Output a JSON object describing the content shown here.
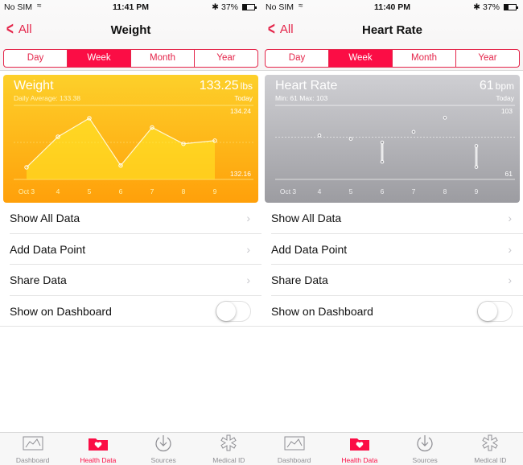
{
  "screens": [
    {
      "status": {
        "carrier": "No SIM",
        "time": "11:41 PM",
        "battery": "37%"
      },
      "nav": {
        "back_label": "All",
        "title": "Weight"
      },
      "segments": [
        {
          "label": "Day",
          "active": false
        },
        {
          "label": "Week",
          "active": true
        },
        {
          "label": "Month",
          "active": false
        },
        {
          "label": "Year",
          "active": false
        }
      ],
      "card": {
        "title": "Weight",
        "subtitle": "Daily Average: 133.38",
        "value": "133.25",
        "unit": "lbs",
        "when": "Today",
        "color_top": "#fdd02a",
        "color_bottom": "#ffa00a"
      },
      "list": [
        {
          "label": "Show All Data"
        },
        {
          "label": "Add Data Point"
        },
        {
          "label": "Share Data"
        },
        {
          "label": "Show on Dashboard",
          "toggle": false
        }
      ]
    },
    {
      "status": {
        "carrier": "No SIM",
        "time": "11:40 PM",
        "battery": "37%"
      },
      "nav": {
        "back_label": "All",
        "title": "Heart Rate"
      },
      "segments": [
        {
          "label": "Day",
          "active": false
        },
        {
          "label": "Week",
          "active": true
        },
        {
          "label": "Month",
          "active": false
        },
        {
          "label": "Year",
          "active": false
        }
      ],
      "card": {
        "title": "Heart Rate",
        "subtitle": "Min: 61  Max: 103",
        "value": "61",
        "unit": "bpm",
        "when": "Today",
        "color_top": "#cfcfd3",
        "color_bottom": "#9c9ca1"
      },
      "list": [
        {
          "label": "Show All Data"
        },
        {
          "label": "Add Data Point"
        },
        {
          "label": "Share Data"
        },
        {
          "label": "Show on Dashboard",
          "toggle": false
        }
      ]
    }
  ],
  "tabbar": [
    {
      "label": "Dashboard",
      "icon": "dashboard-icon",
      "active": false
    },
    {
      "label": "Health Data",
      "icon": "health-data-icon",
      "active": true
    },
    {
      "label": "Sources",
      "icon": "sources-icon",
      "active": false
    },
    {
      "label": "Medical ID",
      "icon": "medical-id-icon",
      "active": false
    }
  ],
  "accent_color": "#fb0d45",
  "chart_data": [
    {
      "type": "line",
      "title": "Weight",
      "categories": [
        "Oct 3",
        "4",
        "5",
        "6",
        "7",
        "8",
        "9"
      ],
      "values": [
        132.5,
        133.36,
        133.88,
        132.55,
        133.62,
        133.16,
        133.25
      ],
      "ylim": [
        132.16,
        134.24
      ],
      "ytick_labels": [
        "134.24",
        "132.16"
      ],
      "average_line": 133.2,
      "xlabel": "",
      "ylabel": "lbs"
    },
    {
      "type": "scatter",
      "title": "Heart Rate",
      "categories": [
        "Oct 3",
        "4",
        "5",
        "6",
        "7",
        "8",
        "9"
      ],
      "ranges": [
        null,
        [
          86,
          86
        ],
        [
          84,
          84
        ],
        [
          71,
          82
        ],
        [
          88,
          88
        ],
        [
          96,
          96
        ],
        [
          68,
          80
        ]
      ],
      "ylim": [
        61,
        103
      ],
      "ytick_labels": [
        "103",
        "61"
      ],
      "average_line": 85,
      "xlabel": "",
      "ylabel": "bpm"
    }
  ]
}
